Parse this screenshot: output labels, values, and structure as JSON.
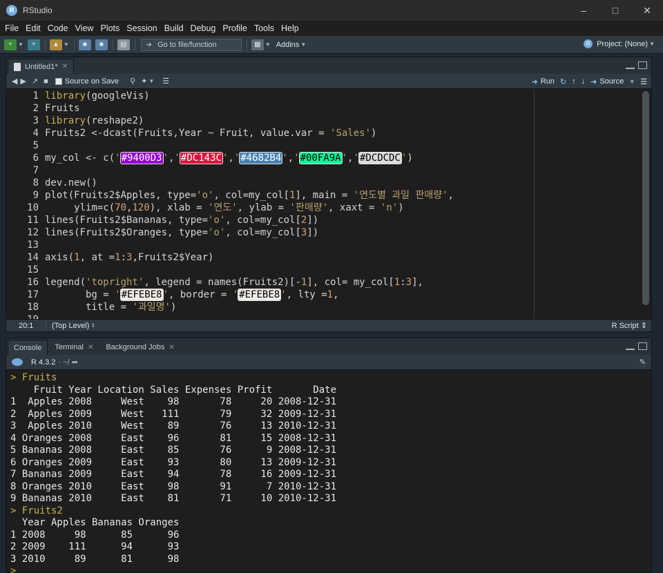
{
  "window": {
    "title": "RStudio",
    "logo_letter": "R"
  },
  "menu": [
    "File",
    "Edit",
    "Code",
    "View",
    "Plots",
    "Session",
    "Build",
    "Debug",
    "Profile",
    "Tools",
    "Help"
  ],
  "toolbar": {
    "goto_placeholder": "Go to file/function",
    "addins_label": "Addins",
    "project_label": "Project: (None)"
  },
  "source": {
    "tab_label": "Untitled1*",
    "source_on_save_label": "Source on Save",
    "run_label": "Run",
    "source_label": "Source",
    "cursor_position": "20:1",
    "scope_label": "(Top Level)",
    "file_type": "R Script",
    "line_numbers": [
      "1",
      "2",
      "3",
      "4",
      "5",
      "6",
      "7",
      "8",
      "9",
      "10",
      "11",
      "12",
      "13",
      "14",
      "15",
      "16",
      "17",
      "18",
      "19"
    ],
    "swatches": {
      "purple": {
        "text": "#9400D3",
        "color": "#9400D3"
      },
      "crimson": {
        "text": "#DC143C",
        "color": "#DC143C"
      },
      "steelblue": {
        "text": "#4682B4",
        "color": "#4682B4"
      },
      "green": {
        "text": "#00FA9A",
        "color": "#00FA9A"
      },
      "gray": {
        "text": "#DCDCDC",
        "color": "#DCDCDC"
      },
      "beige": {
        "text": "#EFEBE8",
        "color": "#EFEBE8"
      }
    }
  },
  "console": {
    "tabs": [
      "Console",
      "Terminal",
      "Background Jobs"
    ],
    "r_version": "R 4.3.2",
    "path": "~/",
    "lines": [
      "> Fruits",
      "    Fruit Year Location Sales Expenses Profit       Date",
      "1  Apples 2008     West    98       78     20 2008-12-31",
      "2  Apples 2009     West   111       79     32 2009-12-31",
      "3  Apples 2010     West    89       76     13 2010-12-31",
      "4 Oranges 2008     East    96       81     15 2008-12-31",
      "5 Bananas 2008     East    85       76      9 2008-12-31",
      "6 Oranges 2009     East    93       80     13 2009-12-31",
      "7 Bananas 2009     East    94       78     16 2009-12-31",
      "8 Oranges 2010     East    98       91      7 2010-12-31",
      "9 Bananas 2010     East    81       71     10 2010-12-31",
      "> Fruits2",
      "  Year Apples Bananas Oranges",
      "1 2008     98      85      96",
      "2 2009    111      94      93",
      "3 2010     89      81      98",
      "> "
    ]
  }
}
